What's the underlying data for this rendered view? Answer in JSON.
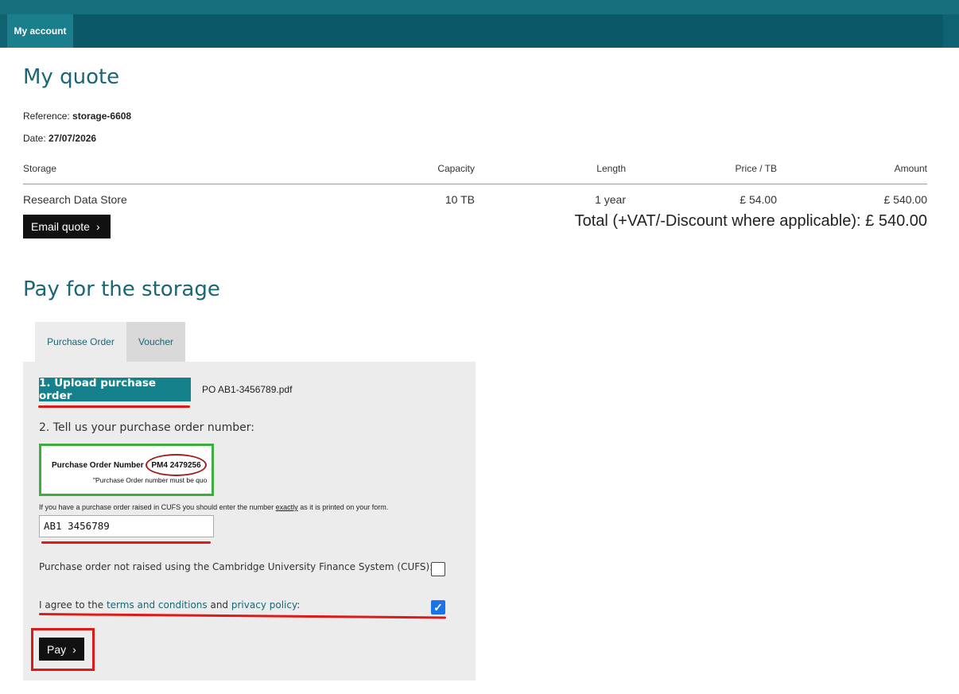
{
  "nav": {
    "tab_label": "My account"
  },
  "quote": {
    "title": "My quote",
    "reference_label": "Reference:",
    "reference_value": "storage-6608",
    "date_label": "Date:",
    "date_value": "27/07/2026",
    "columns": [
      "Storage",
      "Capacity",
      "Length",
      "Price / TB",
      "Amount"
    ],
    "row": {
      "storage": "Research Data Store",
      "capacity": "10 TB",
      "length": "1 year",
      "price_per_tb": "£ 54.00",
      "amount": "£ 540.00"
    },
    "email_button": "Email quote",
    "total": "Total (+VAT/-Discount where applicable): £ 540.00"
  },
  "pay": {
    "title": "Pay for the storage",
    "tabs": [
      "Purchase Order",
      "Voucher"
    ],
    "upload_button": "1. Upload purchase order",
    "uploaded_filename": "PO AB1-3456789.pdf",
    "step2_label": "2. Tell us your purchase order number:",
    "example": {
      "label": "Purchase Order Number",
      "number": "PM4 2479256",
      "note": "\"Purchase Order number must be quo"
    },
    "hint_before": "If you have a purchase order raised in CUFS you should enter the number ",
    "hint_emph": "exactly",
    "hint_after": " as it is printed on your form.",
    "po_number_value": "AB1 3456789",
    "cufs_label": "Purchase order not raised using the Cambridge University Finance System (CUFS):",
    "cufs_checked": false,
    "agree_prefix": "I agree to the ",
    "terms_link": "terms and conditions",
    "agree_and": " and ",
    "privacy_link": "privacy policy",
    "agree_suffix": ":",
    "agree_checked": true,
    "pay_button": "Pay"
  },
  "colors": {
    "header": "#0e6272",
    "accent": "#1a6675",
    "upload_button": "#14818c",
    "annotation_red": "#dd1a1a",
    "annotation_green": "#3bae3b"
  },
  "icons": [
    "chevron-right-icon",
    "checkmark-icon"
  ]
}
